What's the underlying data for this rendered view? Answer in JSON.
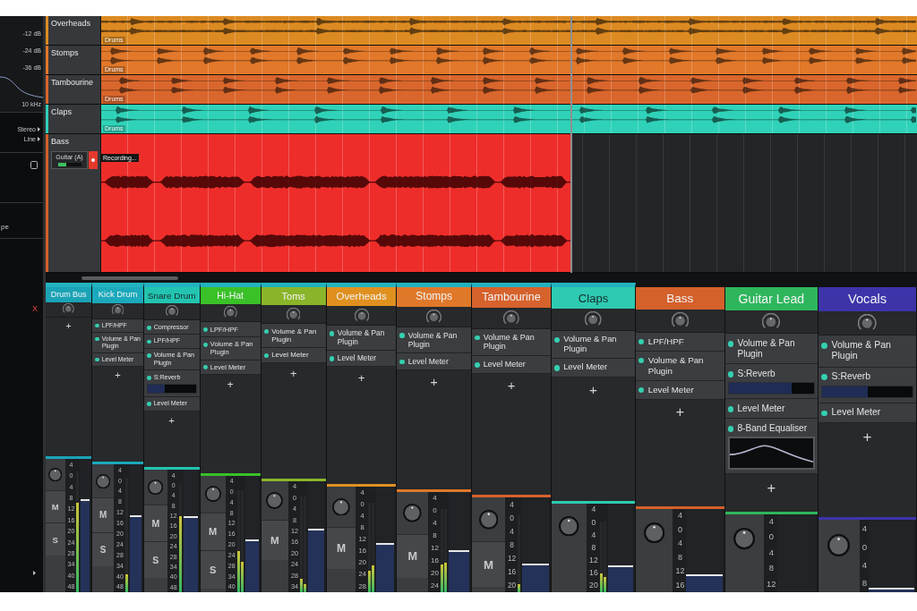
{
  "left_panel": {
    "db_labels": [
      "-12 dB",
      "-24 dB",
      "-36 dB"
    ],
    "frequency_label": "10 kHz",
    "selectors": [
      {
        "label": "Stereo"
      },
      {
        "label": "Line"
      }
    ],
    "checkbox": {
      "checked": false
    },
    "setting_label": "pe",
    "remove_label": "X"
  },
  "timeline": {
    "tracks": [
      {
        "name": "Overheads",
        "color": "#dc8a22",
        "recording": false,
        "clip": {
          "label": "Drums"
        }
      },
      {
        "name": "Stomps",
        "color": "#e2782a",
        "recording": false,
        "clip": {
          "label": "Drums"
        }
      },
      {
        "name": "Tambourine",
        "color": "#d9662c",
        "recording": false,
        "clip": {
          "label": "Drums"
        }
      },
      {
        "name": "Claps",
        "color": "#2fd2b8",
        "recording": false,
        "clip": {
          "label": "Drums"
        }
      },
      {
        "name": "Bass",
        "color": "#d4602a",
        "input": "Guitar (A)",
        "armed": true,
        "recording": true,
        "clip": {
          "status": "Recording..."
        }
      }
    ]
  },
  "mixer": {
    "strips": [
      {
        "name": "Drum Bus",
        "color": "#1ba3b6",
        "in_group": true,
        "add": "+",
        "scale": [
          "4",
          "0",
          "4",
          "8",
          "12",
          "16",
          "20",
          "24",
          "28",
          "34",
          "40",
          "48"
        ],
        "buttons": [
          "M",
          "S"
        ],
        "fader": {
          "level": 0.7
        },
        "meters": [
          {
            "level": 0.74
          }
        ]
      },
      {
        "name": "Kick Drum",
        "color": "#1ba9bb",
        "in_group": true,
        "plugins": [
          {
            "name": "LPF/HPF",
            "kind": "insert",
            "enabled": true
          },
          {
            "name": "Volume & Pan Plugin",
            "kind": "insert",
            "enabled": true
          },
          {
            "name": "Level Meter",
            "kind": "insert",
            "enabled": true
          }
        ],
        "add": "+",
        "scale": [
          "4",
          "0",
          "4",
          "8",
          "12",
          "16",
          "20",
          "24",
          "28",
          "34",
          "40",
          "48"
        ],
        "buttons": [
          "M",
          "S"
        ],
        "fader": {
          "level": 0.6
        },
        "meters": [
          {
            "level": 0.16
          }
        ]
      },
      {
        "name": "Snare Drum",
        "color": "#22c4b0",
        "in_group": true,
        "plugins": [
          {
            "name": "Compressor",
            "kind": "insert",
            "enabled": true
          },
          {
            "name": "LPF/HPF",
            "kind": "insert",
            "enabled": true
          },
          {
            "name": "Volume & Pan Plugin",
            "kind": "insert",
            "enabled": true
          },
          {
            "name": "S:Reverb",
            "kind": "send",
            "enabled": true,
            "level": 0.35
          },
          {
            "name": "Level Meter",
            "kind": "insert",
            "enabled": true
          }
        ],
        "add": "+",
        "scale": [
          "4",
          "0",
          "4",
          "8",
          "12",
          "16",
          "20",
          "24",
          "28",
          "34",
          "40",
          "48"
        ],
        "buttons": [
          "M",
          "S"
        ],
        "fader": {
          "level": 0.62
        },
        "meters": [
          {
            "level": 0.7
          }
        ]
      },
      {
        "name": "Hi-Hat",
        "color": "#3ac028",
        "in_group": true,
        "plugins": [
          {
            "name": "LPF/HPF",
            "kind": "insert",
            "enabled": true
          },
          {
            "name": "Volume & Pan Plugin",
            "kind": "insert",
            "enabled": true
          },
          {
            "name": "Level Meter",
            "kind": "insert",
            "enabled": true
          }
        ],
        "add": "+",
        "scale": [
          "4",
          "0",
          "4",
          "8",
          "12",
          "16",
          "20",
          "24",
          "28",
          "34",
          "40"
        ],
        "buttons": [
          "M",
          "S"
        ],
        "fader": {
          "level": 0.45
        },
        "meters": [
          {
            "level": 0.4
          },
          {
            "level": 0.3
          }
        ]
      },
      {
        "name": "Toms",
        "color": "#8ab52a",
        "in_group": true,
        "plugins": [
          {
            "name": "Volume & Pan Plugin",
            "kind": "insert",
            "enabled": true
          },
          {
            "name": "Level Meter",
            "kind": "insert",
            "enabled": true
          }
        ],
        "add": "+",
        "scale": [
          "4",
          "0",
          "4",
          "8",
          "12",
          "16",
          "20",
          "24",
          "28",
          "34"
        ],
        "buttons": [
          "M"
        ],
        "fader": {
          "level": 0.57
        },
        "meters": [
          {
            "level": 0.14
          },
          {
            "level": 0.08
          }
        ]
      },
      {
        "name": "Overheads",
        "color": "#e0901f",
        "in_group": true,
        "plugins": [
          {
            "name": "Volume & Pan Plugin",
            "kind": "insert",
            "enabled": true
          },
          {
            "name": "Level Meter",
            "kind": "insert",
            "enabled": true
          }
        ],
        "add": "+",
        "scale": [
          "4",
          "0",
          "4",
          "8",
          "12",
          "16",
          "20",
          "24",
          "28"
        ],
        "buttons": [
          "M"
        ],
        "fader": {
          "level": 0.47
        },
        "meters": [
          {
            "level": 0.24
          },
          {
            "level": 0.3
          }
        ]
      },
      {
        "name": "Stomps",
        "color": "#e0782a",
        "in_group": true,
        "plugins": [
          {
            "name": "Volume & Pan Plugin",
            "kind": "insert",
            "enabled": true
          },
          {
            "name": "Level Meter",
            "kind": "insert",
            "enabled": true
          }
        ],
        "add": "+",
        "scale": [
          "4",
          "0",
          "4",
          "8",
          "12",
          "16",
          "20",
          "24"
        ],
        "buttons": [
          "M"
        ],
        "fader": {
          "level": 0.42
        },
        "meters": [
          {
            "level": 0.33
          },
          {
            "level": 0.36
          }
        ]
      },
      {
        "name": "Tambourine",
        "color": "#d6622c",
        "in_group": true,
        "plugins": [
          {
            "name": "Volume & Pan Plugin",
            "kind": "insert",
            "enabled": true
          },
          {
            "name": "Level Meter",
            "kind": "insert",
            "enabled": true
          }
        ],
        "add": "+",
        "scale": [
          "4",
          "0",
          "4",
          "8",
          "12",
          "16",
          "20"
        ],
        "buttons": [
          "M"
        ],
        "fader": {
          "level": 0.3
        },
        "meters": [
          {
            "level": 0.1
          }
        ]
      },
      {
        "name": "Claps",
        "color": "#2ecbb2",
        "in_group": true,
        "plugins": [
          {
            "name": "Volume & Pan Plugin",
            "kind": "insert",
            "enabled": true
          },
          {
            "name": "Level Meter",
            "kind": "insert",
            "enabled": true
          }
        ],
        "add": "+",
        "scale": [
          "4",
          "0",
          "4",
          "8",
          "12",
          "16",
          "20"
        ],
        "fader": {
          "level": 0.3
        },
        "meters": [
          {
            "level": 0.26
          },
          {
            "level": 0.22
          }
        ]
      },
      {
        "name": "Bass",
        "color": "#d4602a",
        "in_group": false,
        "plugins": [
          {
            "name": "LPF/HPF",
            "kind": "insert",
            "enabled": true
          },
          {
            "name": "Volume & Pan Plugin",
            "kind": "insert",
            "enabled": true
          },
          {
            "name": "Level Meter",
            "kind": "insert",
            "enabled": true
          }
        ],
        "add": "+",
        "scale": [
          "4",
          "0",
          "4",
          "8",
          "12",
          "16"
        ],
        "fader": {
          "level": 0.22
        }
      },
      {
        "name": "Guitar Lead",
        "color": "#2eb65c",
        "in_group": false,
        "plugins": [
          {
            "name": "Volume & Pan Plugin",
            "kind": "insert",
            "enabled": true
          },
          {
            "name": "S:Reverb",
            "kind": "send",
            "enabled": true,
            "level": 0.74
          },
          {
            "name": "Level Meter",
            "kind": "insert",
            "enabled": true
          },
          {
            "name": "8-Band Equaliser",
            "kind": "eq",
            "enabled": true
          }
        ],
        "add": "+",
        "scale": [
          "4",
          "0",
          "4",
          "8",
          "12"
        ]
      },
      {
        "name": "Vocals",
        "color": "#3d34aa",
        "in_group": false,
        "plugins": [
          {
            "name": "Volume & Pan Plugin",
            "kind": "insert",
            "enabled": true
          },
          {
            "name": "S:Reverb",
            "kind": "send",
            "enabled": true,
            "level": 0.5
          },
          {
            "name": "Level Meter",
            "kind": "insert",
            "enabled": true
          }
        ],
        "add": "+",
        "scale": [
          "4",
          "0",
          "4",
          "8"
        ],
        "fader": {
          "level": 0.06
        }
      }
    ]
  }
}
